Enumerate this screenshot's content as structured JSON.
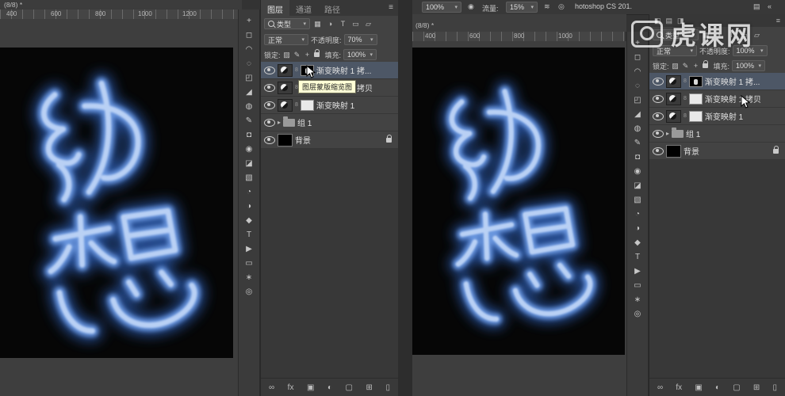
{
  "watermark": {
    "text": "虎课网"
  },
  "options_bar": {
    "opacity_value": "100%",
    "flow_label": "流量:",
    "flow_value": "15%",
    "icons": [
      "◉",
      "≋",
      "◎"
    ],
    "title_fragment": "hotoshop CS 201."
  },
  "left_view": {
    "tab_fragment": "(8/8) *",
    "ruler_ticks": [
      "400",
      "600",
      "800",
      "1000",
      "1200"
    ]
  },
  "right_view": {
    "tab_fragment": "(8/8) *",
    "ruler_ticks": [
      "400",
      "600",
      "800",
      "1000"
    ]
  },
  "glyphs": {
    "dropdown_arrow": "▾",
    "chain": "8",
    "group_arrow": "▸",
    "menu": "≡",
    "collapse": "«",
    "panel_grid": "▤"
  },
  "tools": [
    {
      "name": "move-tool",
      "glyph": "+"
    },
    {
      "name": "marquee-tool",
      "glyph": "◻"
    },
    {
      "name": "lasso-tool",
      "glyph": "◠"
    },
    {
      "name": "quick-select-tool",
      "glyph": "◌"
    },
    {
      "name": "crop-tool",
      "glyph": "◰"
    },
    {
      "name": "eyedropper-tool",
      "glyph": "◢"
    },
    {
      "name": "healing-brush-tool",
      "glyph": "◍"
    },
    {
      "name": "brush-tool",
      "glyph": "✎"
    },
    {
      "name": "clone-stamp-tool",
      "glyph": "◘"
    },
    {
      "name": "history-brush-tool",
      "glyph": "◉"
    },
    {
      "name": "eraser-tool",
      "glyph": "◪"
    },
    {
      "name": "gradient-tool",
      "glyph": "▧"
    },
    {
      "name": "blur-tool",
      "glyph": "◔"
    },
    {
      "name": "dodge-tool",
      "glyph": "◑"
    },
    {
      "name": "pen-tool",
      "glyph": "◆"
    },
    {
      "name": "type-tool",
      "glyph": "T"
    },
    {
      "name": "path-select-tool",
      "glyph": "▶"
    },
    {
      "name": "shape-tool",
      "glyph": "▭"
    },
    {
      "name": "hand-tool",
      "glyph": "∗"
    },
    {
      "name": "zoom-tool",
      "glyph": "◎"
    }
  ],
  "layers_left": {
    "tabs": [
      "图层",
      "通道",
      "路径"
    ],
    "kind_label": "类型",
    "filter_icons": [
      "▦",
      "◑",
      "T",
      "▭",
      "▱"
    ],
    "blend_mode": "正常",
    "opacity_label": "不透明度:",
    "opacity_value": "70%",
    "lock_label": "锁定:",
    "lock_icons": [
      "▨",
      "✎",
      "+"
    ],
    "fill_label": "填充:",
    "fill_value": "100%",
    "rows": [
      {
        "name": "渐变映射 1 拷..."
      },
      {
        "name": "渐变映射 1 拷贝"
      },
      {
        "name": "渐变映射 1"
      },
      {
        "name": "组 1"
      },
      {
        "name": "背景"
      }
    ],
    "tooltip": "图层蒙版缩览图",
    "bottom_icons": [
      "∞",
      "fx",
      "▣",
      "◐",
      "▢",
      "⊞",
      "▯"
    ]
  },
  "layers_right": {
    "header_icons": [
      "◧",
      "▤",
      "◨"
    ],
    "kind_label": "类型",
    "filter_icons": [
      "▦",
      "◑",
      "T",
      "▭",
      "▱"
    ],
    "blend_mode": "正常",
    "opacity_label": "不透明度:",
    "opacity_value": "100%",
    "lock_label": "锁定:",
    "lock_icons": [
      "▨",
      "✎",
      "+"
    ],
    "fill_label": "填充:",
    "fill_value": "100%",
    "rows": [
      {
        "name": "渐变映射 1 拷..."
      },
      {
        "name": "渐变映射 1 拷贝"
      },
      {
        "name": "渐变映射 1"
      },
      {
        "name": "组 1"
      },
      {
        "name": "背景"
      }
    ],
    "bottom_icons": [
      "∞",
      "fx",
      "▣",
      "◐",
      "▢",
      "⊞",
      "▯"
    ]
  }
}
